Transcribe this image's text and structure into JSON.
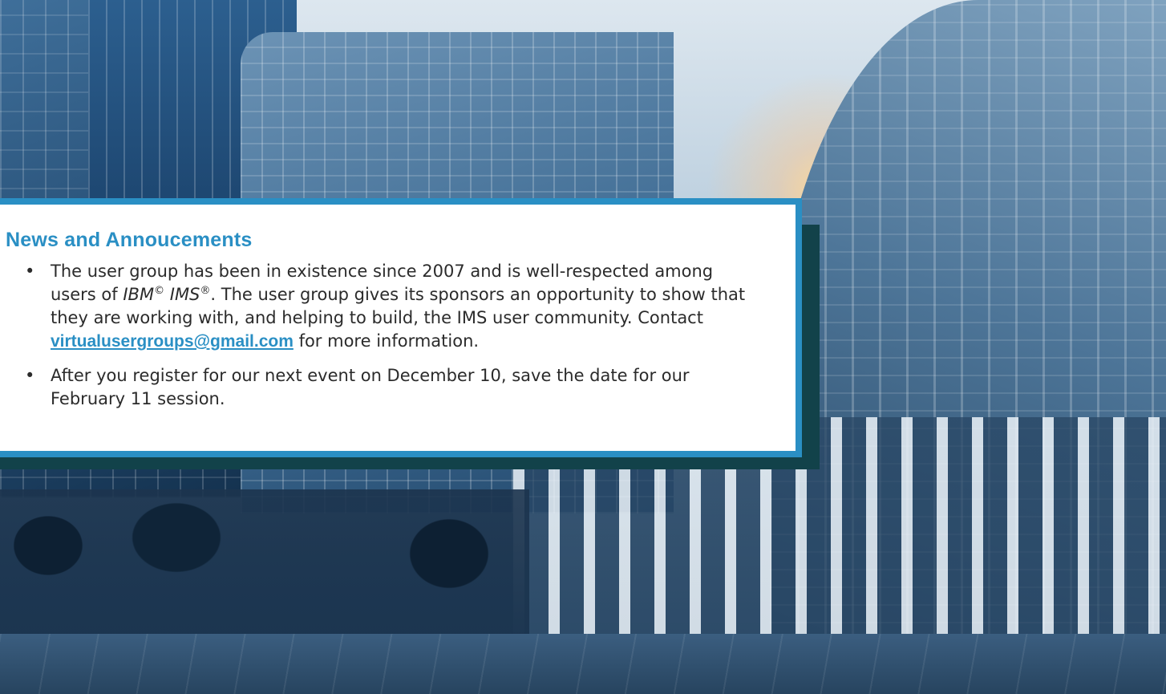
{
  "colors": {
    "accent": "#2a8fc4",
    "shadow": "#12424a",
    "card_background": "#ffffff",
    "text": "#2b2b2b"
  },
  "announcements": {
    "title": "News and Annoucements",
    "items": [
      {
        "text_before": "The user group has been in existence since 2007 and is well-respected among users of ",
        "product_1": "IBM",
        "product_1_mark": "©",
        "product_2": "IMS",
        "product_2_mark": "®",
        "text_middle": ". The user group gives its sponsors an opportunity to show that they are working with, and helping to build, the IMS user community. Contact ",
        "link_text": "virtualusergroups@gmail.com",
        "text_after": " for more information."
      },
      {
        "text": "After you register for our next event on December 10, save the date for our February 11 session."
      }
    ]
  }
}
